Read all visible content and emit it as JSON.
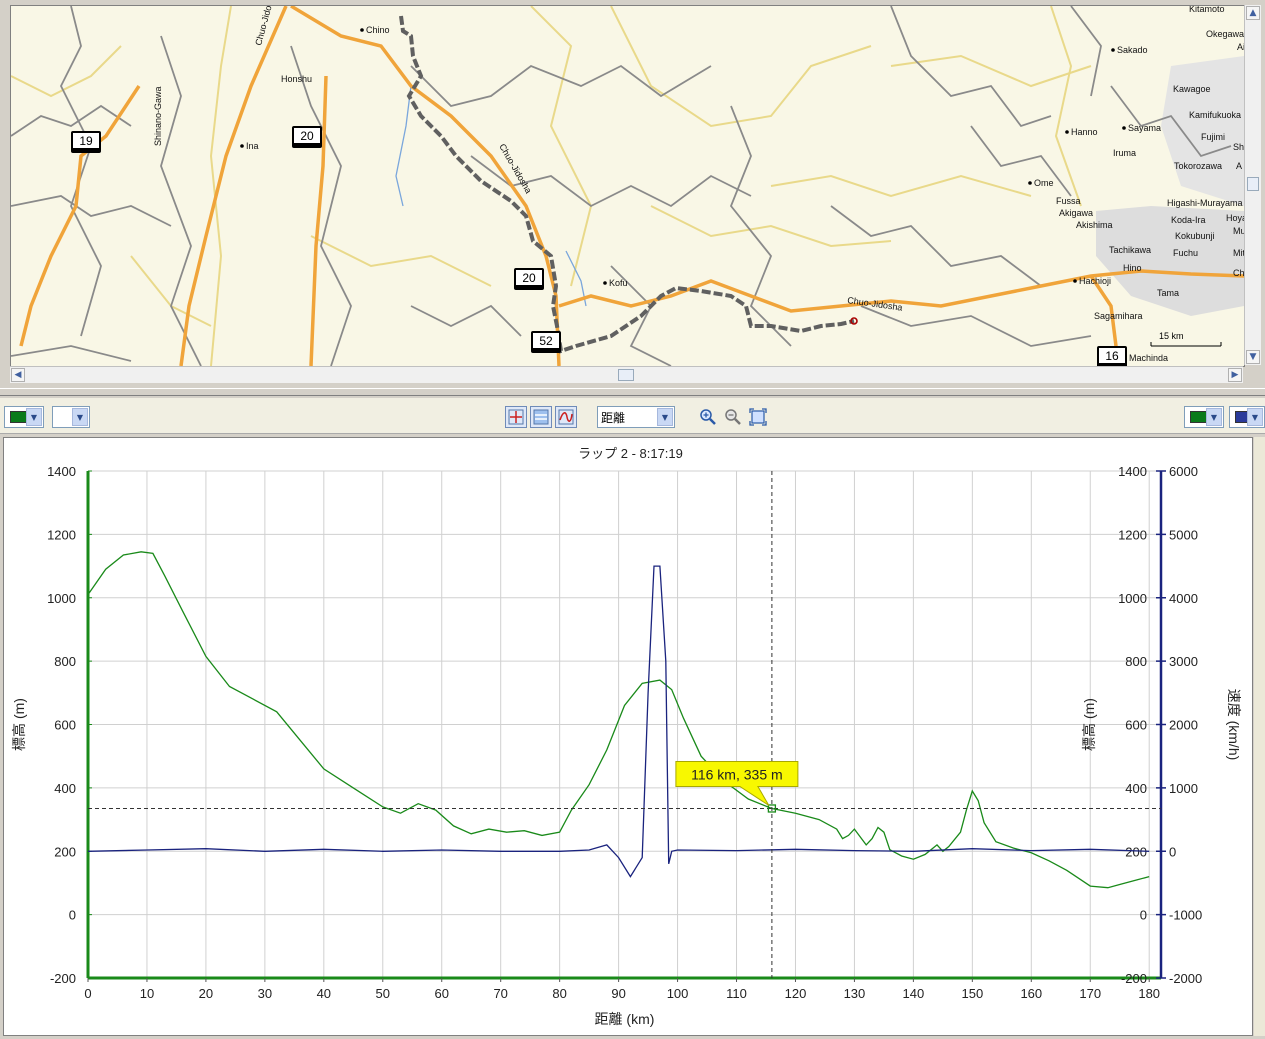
{
  "map": {
    "places": [
      {
        "name": "Chino"
      },
      {
        "name": "Honshu"
      },
      {
        "name": "Ina"
      },
      {
        "name": "Shinano-Gawa"
      },
      {
        "name": "Chuo-Jidosha"
      },
      {
        "name": "Chuo-Jidosha"
      },
      {
        "name": "Kofu"
      },
      {
        "name": "Chuo-Jidosha"
      },
      {
        "name": "Kitamoto"
      },
      {
        "name": "Okegawa"
      },
      {
        "name": "Ai"
      },
      {
        "name": "Sakado"
      },
      {
        "name": "Kawagoe"
      },
      {
        "name": "Kamifukuoka"
      },
      {
        "name": "Hanno"
      },
      {
        "name": "Sayama"
      },
      {
        "name": "Fujimi"
      },
      {
        "name": "Sh"
      },
      {
        "name": "Iruma"
      },
      {
        "name": "Tokorozawa"
      },
      {
        "name": "A"
      },
      {
        "name": "Ome"
      },
      {
        "name": "Fussa"
      },
      {
        "name": "Higashi-Murayama"
      },
      {
        "name": "Akigawa"
      },
      {
        "name": "Koda-Ira"
      },
      {
        "name": "Hoya"
      },
      {
        "name": "Akishima"
      },
      {
        "name": "Kokubunji"
      },
      {
        "name": "Mu"
      },
      {
        "name": "Tachikawa"
      },
      {
        "name": "Fuchu"
      },
      {
        "name": "Mit"
      },
      {
        "name": "Hino"
      },
      {
        "name": "Ch"
      },
      {
        "name": "Hachioji"
      },
      {
        "name": "Tama"
      },
      {
        "name": "Sagamihara"
      },
      {
        "name": "Machinda"
      }
    ],
    "route_shields": [
      "19",
      "20",
      "20",
      "52",
      "16"
    ],
    "scale_label": "15 km",
    "colors": {
      "background": "#f9f7e6",
      "highway": "#f0a43a",
      "road": "#8a8a8a",
      "minor_road": "#e9d98a",
      "track": "#606060",
      "river": "#7aa6dc",
      "urban": "#dddddd"
    }
  },
  "toolbar": {
    "left_color_1": "#0a7a1a",
    "left_color_2": "#ffffff",
    "axis_select": "距離",
    "right_color_1": "#0a7a1a",
    "right_color_2": "#2a3a9a",
    "icons": [
      "crosshair-icon",
      "horizontal-lines-icon",
      "curve-icon",
      "zoom-in-icon",
      "zoom-out-icon",
      "zoom-extent-icon"
    ]
  },
  "chart_data": {
    "type": "line",
    "title": "ラップ 2 - 8:17:19",
    "xlabel": "距離 (km)",
    "ylabel_left": "標高 (m)",
    "ylabel_right_inner": "標高 (m)",
    "ylabel_right_outer": "速度 (km/h)",
    "xlim": [
      0,
      182
    ],
    "ylim_left": [
      -200,
      1400
    ],
    "ylim_right": [
      -2000,
      6000
    ],
    "xticks": [
      0,
      10,
      20,
      30,
      40,
      50,
      60,
      70,
      80,
      90,
      100,
      110,
      120,
      130,
      140,
      150,
      160,
      170,
      180
    ],
    "yticks_left": [
      -200,
      0,
      200,
      400,
      600,
      800,
      1000,
      1200,
      1400
    ],
    "yticks_right": [
      -2000,
      -1000,
      0,
      1000,
      2000,
      3000,
      4000,
      5000,
      6000
    ],
    "grid": true,
    "cursor": {
      "x": 116,
      "y": 335,
      "label": "116 km, 335 m"
    },
    "series": [
      {
        "color": "#1a8a1a",
        "axis": "left",
        "x": [
          0,
          3,
          6,
          9,
          11,
          13,
          16,
          20,
          24,
          28,
          32,
          36,
          40,
          45,
          50,
          53,
          56,
          59,
          62,
          65,
          68,
          71,
          74,
          77,
          80,
          82,
          85,
          88,
          91,
          94,
          97,
          99,
          101,
          104,
          108,
          112,
          116,
          120,
          124,
          127,
          128,
          129,
          130,
          131,
          132,
          133,
          134,
          135,
          136,
          137,
          138,
          140,
          142,
          144,
          145,
          146,
          148,
          149,
          150,
          151,
          152,
          154,
          157,
          160,
          163,
          166,
          168,
          170,
          173,
          175,
          178,
          180
        ],
        "values": [
          1010,
          1090,
          1135,
          1145,
          1140,
          1070,
          960,
          815,
          720,
          680,
          640,
          550,
          460,
          400,
          340,
          320,
          350,
          330,
          280,
          255,
          270,
          260,
          265,
          250,
          260,
          330,
          410,
          520,
          660,
          730,
          740,
          710,
          620,
          500,
          420,
          365,
          335,
          320,
          300,
          270,
          240,
          250,
          270,
          245,
          220,
          240,
          275,
          260,
          205,
          195,
          185,
          175,
          190,
          220,
          200,
          215,
          260,
          330,
          390,
          360,
          290,
          230,
          210,
          195,
          170,
          140,
          115,
          90,
          85,
          95,
          110,
          120
        ]
      },
      {
        "color": "#1a237e",
        "axis": "right",
        "x": [
          0,
          10,
          20,
          30,
          40,
          50,
          60,
          70,
          80,
          85,
          88,
          90,
          92,
          94,
          95,
          96,
          97,
          98,
          98.5,
          99,
          100,
          110,
          120,
          130,
          140,
          150,
          160,
          170,
          180
        ],
        "values": [
          0,
          20,
          40,
          0,
          30,
          0,
          20,
          0,
          0,
          20,
          100,
          -100,
          -400,
          -100,
          2500,
          4500,
          4500,
          3000,
          -200,
          0,
          20,
          10,
          30,
          10,
          0,
          40,
          10,
          30,
          0
        ]
      }
    ]
  }
}
